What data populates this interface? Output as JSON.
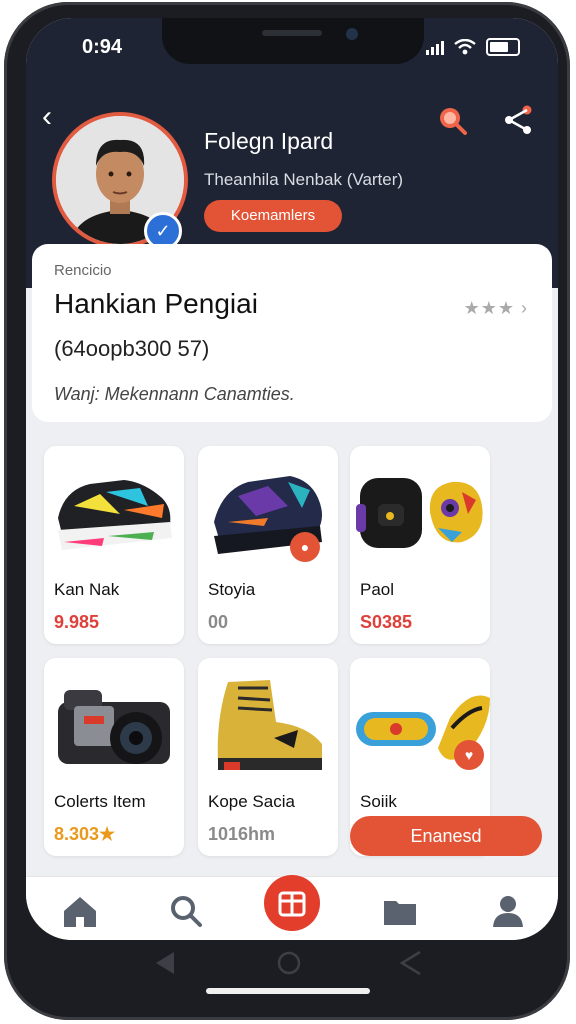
{
  "status_bar": {
    "time": "0:94"
  },
  "profile": {
    "name": "Folegn Ipard",
    "subtitle": "Theanhila Nenbak (Varter)",
    "follow_label": "Koemamlers"
  },
  "info_card": {
    "eyebrow": "Rencicio",
    "title": "Hankian Pengiai",
    "stats": "(64oopb300 57)",
    "footer": "Wanj: Mekennann Canamties."
  },
  "products": [
    {
      "name": "Kan Nak",
      "price": "9.985",
      "price_color": "#e0403a"
    },
    {
      "name": "Stoyia",
      "price": "00",
      "price_color": "#8a8a8a"
    },
    {
      "name": "Paol",
      "price": "S0385",
      "price_color": "#e0403a"
    },
    {
      "name": "Colerts Item",
      "price": "8.303",
      "price_color": "#e99a1c"
    },
    {
      "name": "Kope Sacia",
      "price": "1016hm",
      "price_color": "#8a8a8a"
    },
    {
      "name": "Soiik",
      "price": "",
      "price_color": "#8a8a8a"
    }
  ],
  "cta_label": "Enanesd",
  "colors": {
    "accent": "#e35335",
    "header": "#1e2433"
  }
}
